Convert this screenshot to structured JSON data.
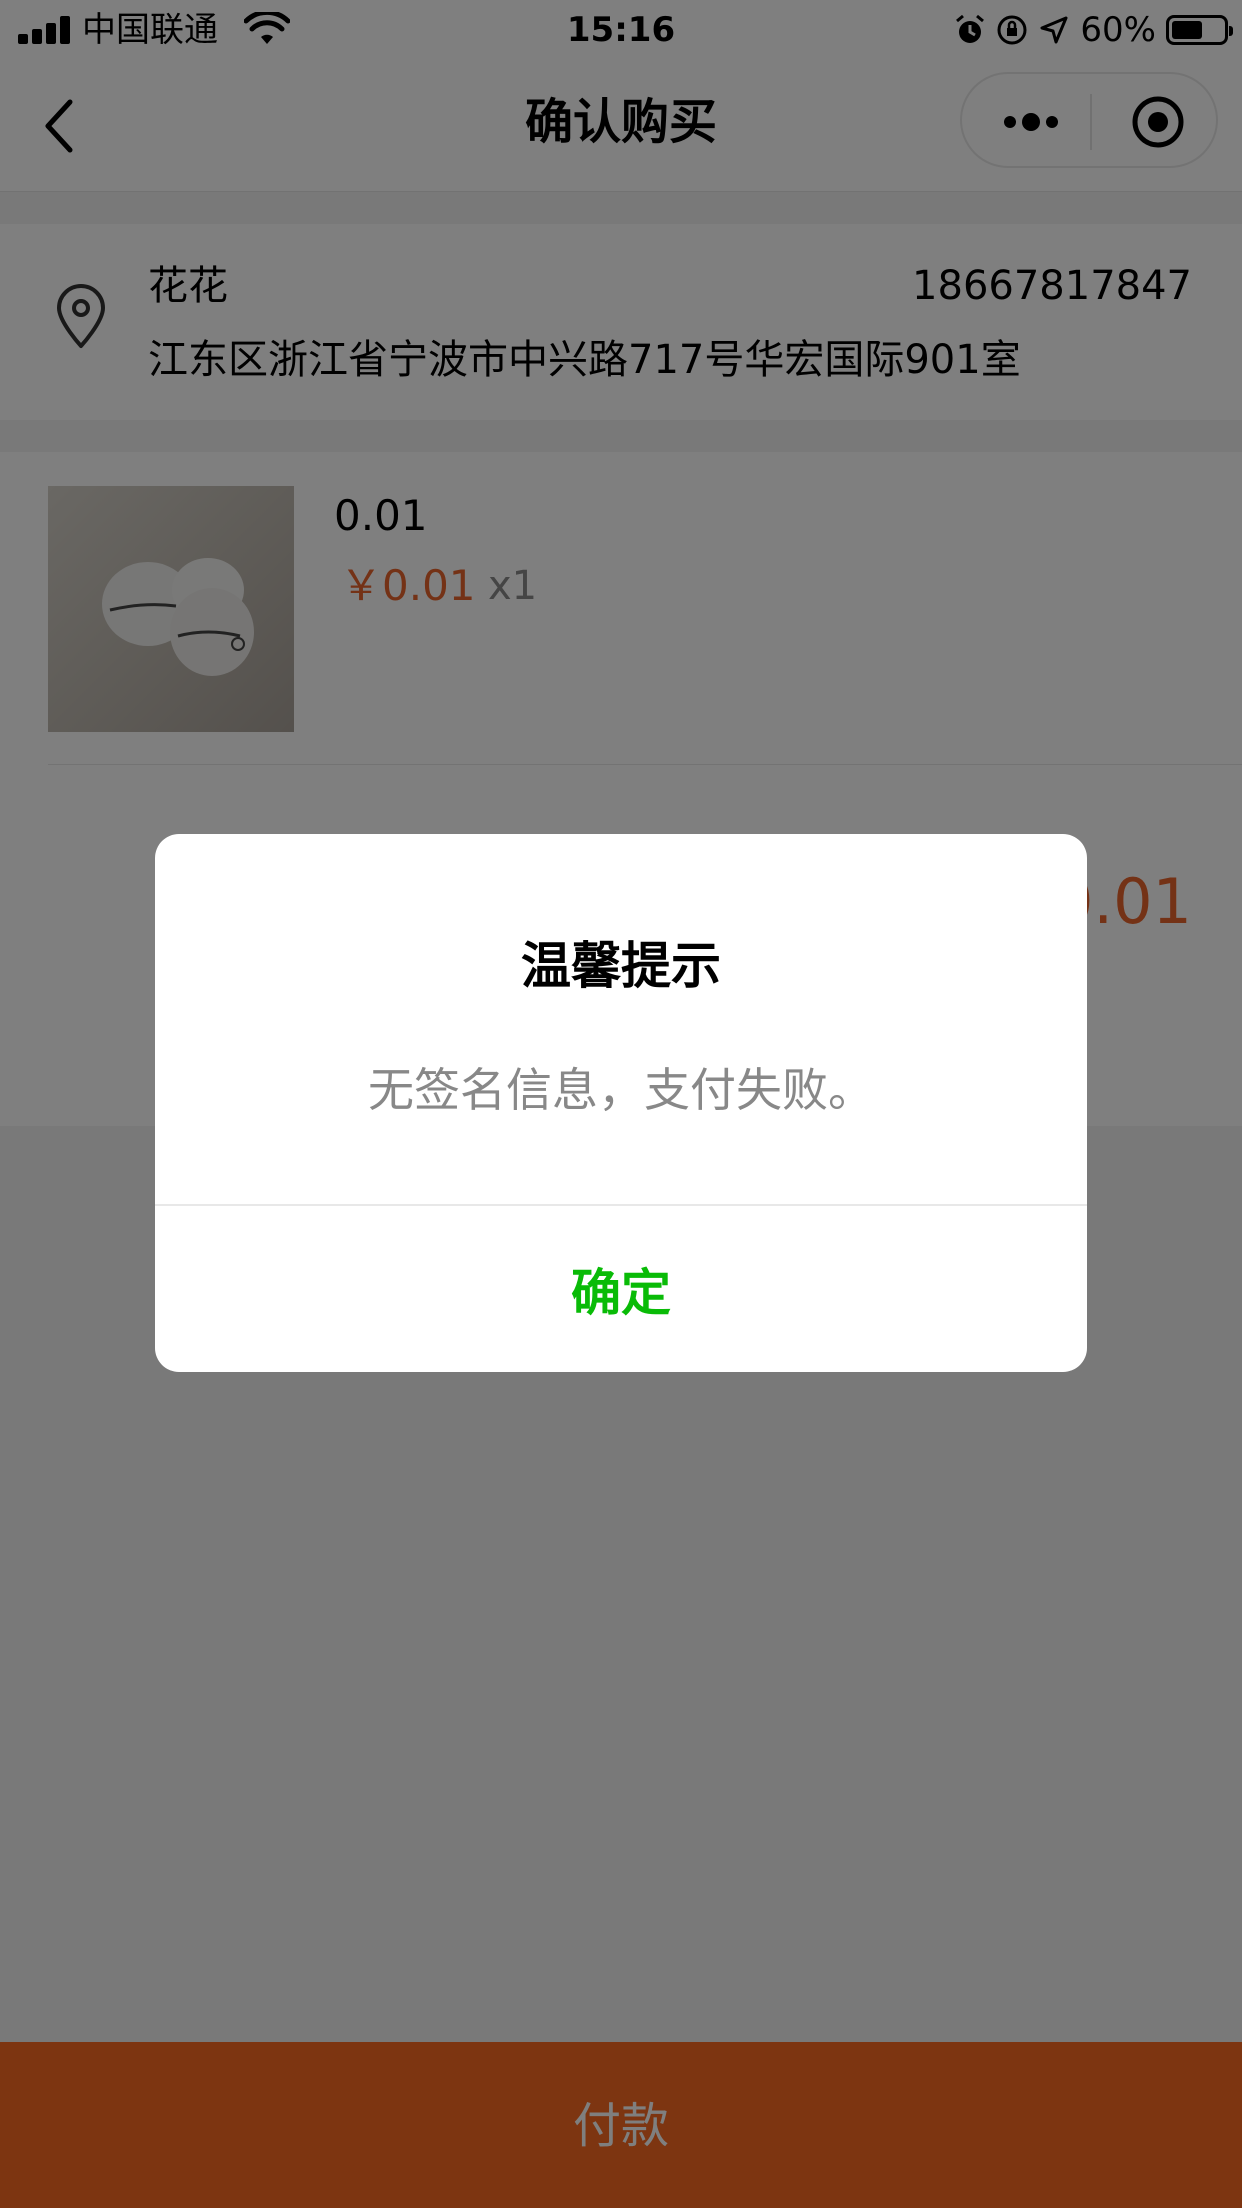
{
  "status_bar": {
    "carrier": "中国联通",
    "time": "15:16",
    "battery": "60%",
    "battery_level": 0.6
  },
  "nav": {
    "title": "确认购买"
  },
  "address": {
    "name": "花花",
    "phone": "18667817847",
    "detail": "江东区浙江省宁波市中兴路717号华宏国际901室"
  },
  "product": {
    "name": "0.01",
    "price": "￥0.01",
    "quantity": "x1"
  },
  "total": {
    "amount": "0.01"
  },
  "pay_button": {
    "label": "付款"
  },
  "dialog": {
    "title": "温馨提示",
    "message": "无签名信息，支付失败。",
    "confirm_label": "确定"
  },
  "colors": {
    "accent_orange": "#e8642c",
    "pay_bar": "#fa6a22",
    "confirm_green": "#09bb07"
  }
}
